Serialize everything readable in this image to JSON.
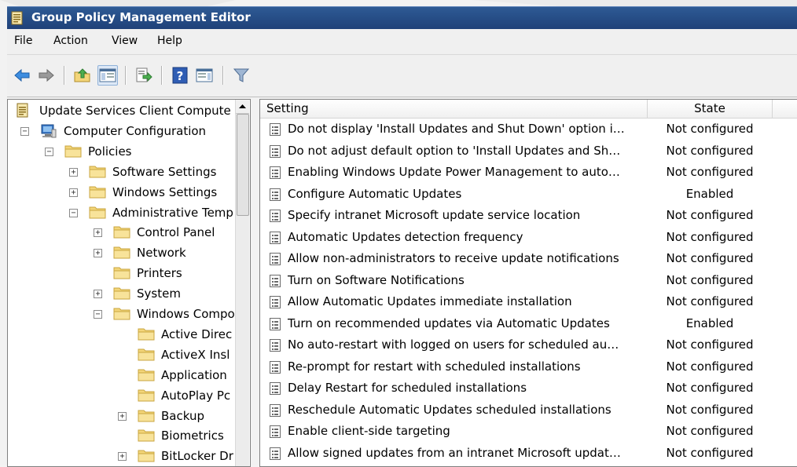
{
  "window": {
    "title": "Group Policy Management Editor"
  },
  "menu": [
    "File",
    "Action",
    "View",
    "Help"
  ],
  "toolbar": {
    "buttons": [
      "back-icon",
      "forward-icon",
      "up-folder-icon",
      "show-hide-tree-icon",
      "export-list-icon",
      "help-icon",
      "properties-pane-icon",
      "filter-icon"
    ]
  },
  "tree": [
    {
      "label": "Update Services Client Compute",
      "indent": 0,
      "expander": "",
      "icon": "policy"
    },
    {
      "label": "Computer Configuration",
      "indent": 1,
      "expander": "−",
      "icon": "computer"
    },
    {
      "label": "Policies",
      "indent": 2,
      "expander": "−",
      "icon": "folder"
    },
    {
      "label": "Software Settings",
      "indent": 3,
      "expander": "+",
      "icon": "folder"
    },
    {
      "label": "Windows Settings",
      "indent": 3,
      "expander": "+",
      "icon": "folder"
    },
    {
      "label": "Administrative Temp",
      "indent": 3,
      "expander": "−",
      "icon": "folder"
    },
    {
      "label": "Control Panel",
      "indent": 4,
      "expander": "+",
      "icon": "folder"
    },
    {
      "label": "Network",
      "indent": 4,
      "expander": "+",
      "icon": "folder"
    },
    {
      "label": "Printers",
      "indent": 4,
      "expander": "",
      "icon": "folder"
    },
    {
      "label": "System",
      "indent": 4,
      "expander": "+",
      "icon": "folder"
    },
    {
      "label": "Windows Compo",
      "indent": 4,
      "expander": "−",
      "icon": "folder"
    },
    {
      "label": "Active Direc",
      "indent": 5,
      "expander": "",
      "icon": "folder"
    },
    {
      "label": "ActiveX Insl",
      "indent": 5,
      "expander": "",
      "icon": "folder"
    },
    {
      "label": "Application",
      "indent": 5,
      "expander": "",
      "icon": "folder"
    },
    {
      "label": "AutoPlay Pc",
      "indent": 5,
      "expander": "",
      "icon": "folder"
    },
    {
      "label": "Backup",
      "indent": 5,
      "expander": "+",
      "icon": "folder"
    },
    {
      "label": "Biometrics",
      "indent": 5,
      "expander": "",
      "icon": "folder"
    },
    {
      "label": "BitLocker Dr",
      "indent": 5,
      "expander": "+",
      "icon": "folder"
    }
  ],
  "list": {
    "columns": {
      "setting": "Setting",
      "state": "State"
    },
    "rows": [
      {
        "setting": "Do not display 'Install Updates and Shut Down' option i…",
        "state": "Not configured"
      },
      {
        "setting": "Do not adjust default option to 'Install Updates and Sh…",
        "state": "Not configured"
      },
      {
        "setting": "Enabling Windows Update Power Management to auto…",
        "state": "Not configured"
      },
      {
        "setting": "Configure Automatic Updates",
        "state": "Enabled"
      },
      {
        "setting": "Specify intranet Microsoft update service location",
        "state": "Not configured"
      },
      {
        "setting": "Automatic Updates detection frequency",
        "state": "Not configured"
      },
      {
        "setting": "Allow non-administrators to receive update notifications",
        "state": "Not configured"
      },
      {
        "setting": "Turn on Software Notifications",
        "state": "Not configured"
      },
      {
        "setting": "Allow Automatic Updates immediate installation",
        "state": "Not configured"
      },
      {
        "setting": "Turn on recommended updates via Automatic Updates",
        "state": "Enabled"
      },
      {
        "setting": "No auto-restart with logged on users for scheduled au…",
        "state": "Not configured"
      },
      {
        "setting": "Re-prompt for restart with scheduled installations",
        "state": "Not configured"
      },
      {
        "setting": "Delay Restart for scheduled installations",
        "state": "Not configured"
      },
      {
        "setting": "Reschedule Automatic Updates scheduled installations",
        "state": "Not configured"
      },
      {
        "setting": "Enable client-side targeting",
        "state": "Not configured"
      },
      {
        "setting": "Allow signed updates from an intranet Microsoft updat…",
        "state": "Not configured"
      }
    ]
  },
  "colors": {
    "titlebar": "#1f4179",
    "title_text": "#ffffff",
    "folder": "#f3d579"
  }
}
